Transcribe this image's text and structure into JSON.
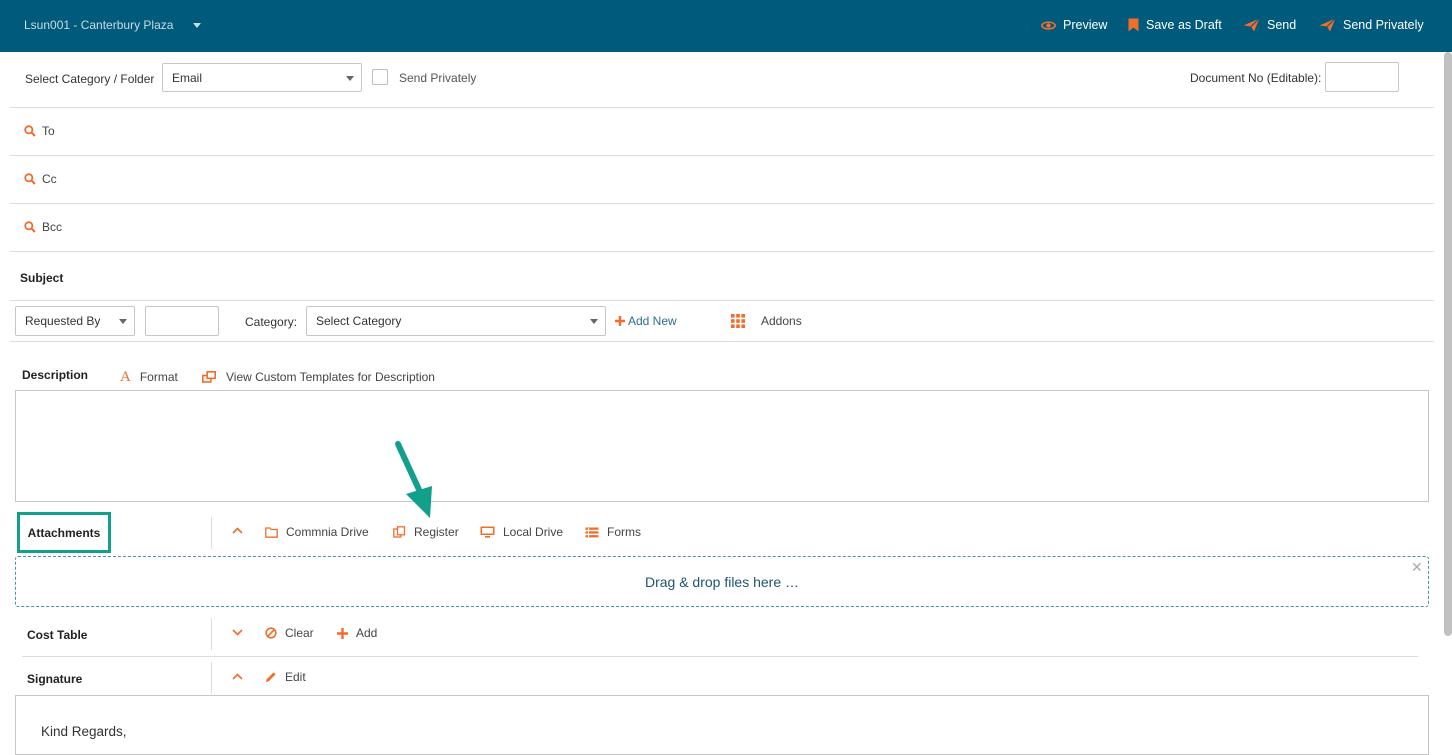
{
  "header": {
    "project": "Lsun001 - Canterbury Plaza",
    "actions": {
      "preview": "Preview",
      "save_draft": "Save as Draft",
      "send": "Send",
      "send_privately": "Send Privately"
    }
  },
  "form": {
    "category_label": "Select Category / Folder",
    "category_value": "Email",
    "send_privately_label": "Send Privately",
    "doc_no_label": "Document No (Editable):",
    "doc_no_value": "",
    "to_label": "To",
    "cc_label": "Cc",
    "bcc_label": "Bcc",
    "subject_label": "Subject",
    "requested_by_value": "Requested By",
    "requested_by_input": "",
    "cat_label": "Category:",
    "cat_value": "Select Category",
    "add_new": "Add New",
    "addons": "Addons",
    "description_label": "Description",
    "format": "Format",
    "templates": "View Custom Templates for Description"
  },
  "attachments": {
    "label": "Attachments",
    "commnia_drive": "Commnia Drive",
    "register": "Register",
    "local_drive": "Local Drive",
    "forms": "Forms",
    "dropzone": "Drag & drop files here …"
  },
  "cost_table": {
    "label": "Cost Table",
    "clear": "Clear",
    "add": "Add"
  },
  "signature": {
    "label": "Signature",
    "edit": "Edit",
    "text": "Kind Regards,"
  },
  "colors": {
    "header": "#005a7b",
    "accent": "#f26c2b",
    "highlight": "#12a08c",
    "dropzone_text": "#1f5470"
  }
}
